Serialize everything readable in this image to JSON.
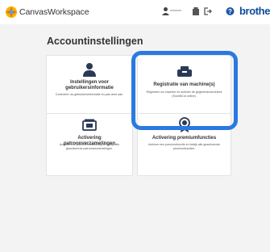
{
  "header": {
    "app_name": "CanvasWorkspace",
    "user_name": "xxxxxxx",
    "brand": "brother",
    "icons": [
      "user-icon",
      "document-icon",
      "logout-icon",
      "help-icon"
    ],
    "brand_color": "#0d4a9c"
  },
  "page": {
    "title": "Accountinstellingen"
  },
  "cards": [
    {
      "icon": "user-icon",
      "title": "Instellingen voor gebruikersinformatie",
      "description": "Controleer uw gebruikersinformatie en pas deze aan."
    },
    {
      "icon": "machine-icon",
      "title": "Registratie van machine(s)",
      "description": "Registreer uw machine en activeer de gegevensoverdracht (ScanNCut online)."
    },
    {
      "icon": "pattern-collection-icon",
      "title": "Activering patroonverzamelingen",
      "description": "Activeer een patroonverzameling en bekijk alle geactiveerde patroonverzamelingen."
    },
    {
      "icon": "premium-badge-icon",
      "title": "Activering premiumfuncties",
      "description": "Activeer een premiumfunctie en bekijk alle geactiveerde premiumfuncties."
    }
  ],
  "highlight_color": "#2a79e1"
}
